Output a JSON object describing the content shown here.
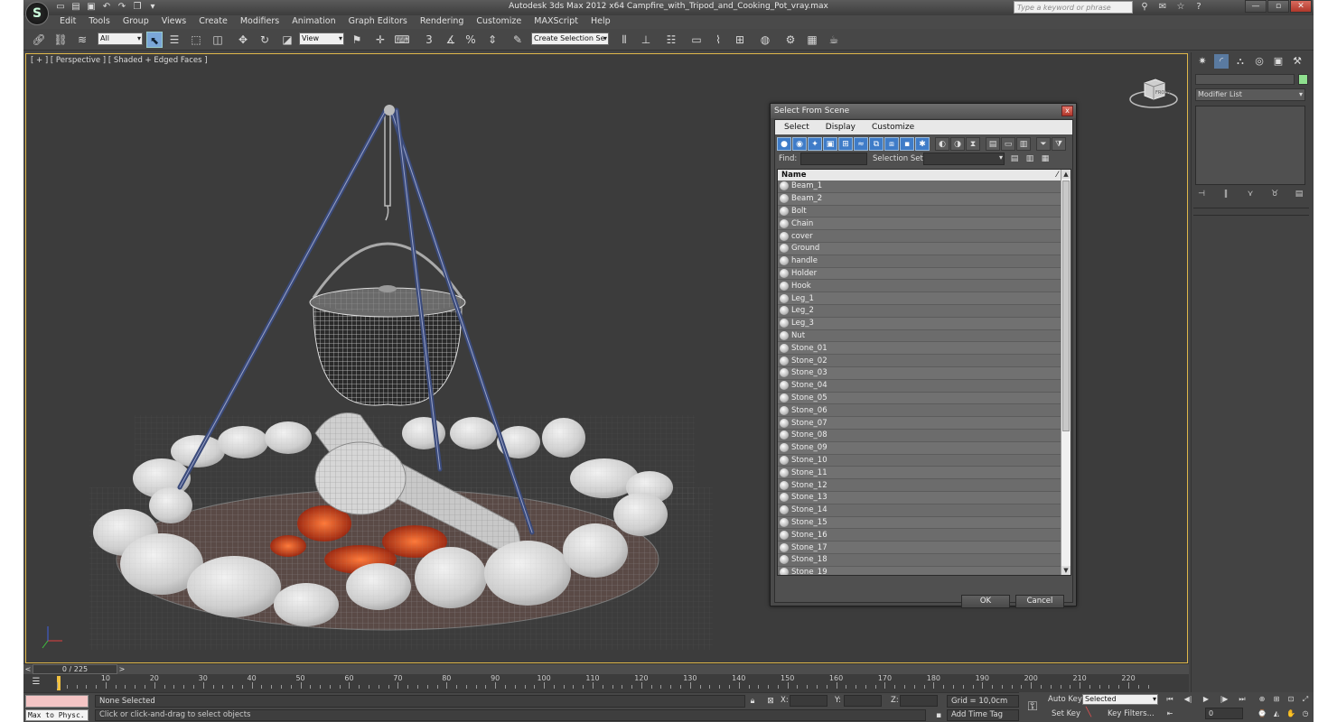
{
  "titlebar": {
    "title": "Autodesk 3ds Max  2012 x64      Campfire_with_Tripod_and_Cooking_Pot_vray.max",
    "search_placeholder": "Type a keyword or phrase"
  },
  "menu": [
    "Edit",
    "Tools",
    "Group",
    "Views",
    "Create",
    "Modifiers",
    "Animation",
    "Graph Editors",
    "Rendering",
    "Customize",
    "MAXScript",
    "Help"
  ],
  "toolbar": {
    "selection_filter": "All",
    "reference_coord": "View",
    "named_selection": "Create Selection Se",
    "snap_toggle": "3",
    "percent_snap": "%"
  },
  "viewport": {
    "label": "[ + ] [ Perspective ] [ Shaded + Edged Faces ]",
    "viewcube_label": "FRONT"
  },
  "command_panel": {
    "modifier_list": "Modifier List",
    "accent_color": "#8fe08f"
  },
  "time_slider": {
    "position": "0 / 225",
    "prev_arrow": "<",
    "next_arrow": ">"
  },
  "track_ticks": [
    "10",
    "20",
    "30",
    "40",
    "50",
    "60",
    "70",
    "80",
    "90",
    "100",
    "110",
    "120",
    "130",
    "140",
    "150",
    "160",
    "170",
    "180",
    "190",
    "200",
    "210",
    "220"
  ],
  "status": {
    "maxscript_label": "Max to Physc.",
    "selection": "None Selected",
    "prompt": "Click or click-and-drag to select objects",
    "x_label": "X:",
    "y_label": "Y:",
    "z_label": "Z:",
    "grid": "Grid = 10,0cm",
    "add_time_tag": "Add Time Tag"
  },
  "anim": {
    "auto_key": "Auto Key",
    "set_key": "Set Key",
    "selected": "Selected",
    "key_filters": "Key Filters...",
    "current_frame": "0"
  },
  "dialog": {
    "title": "Select From Scene",
    "close": "x",
    "menu": [
      "Select",
      "Display",
      "Customize"
    ],
    "find_label": "Find:",
    "selset_label": "Selection Set:",
    "column_name": "Name",
    "ok": "OK",
    "cancel": "Cancel",
    "objects": [
      "Beam_1",
      "Beam_2",
      "Bolt",
      "Chain",
      "cover",
      "Ground",
      "handle",
      "Holder",
      "Hook",
      "Leg_1",
      "Leg_2",
      "Leg_3",
      "Nut",
      "Stone_01",
      "Stone_02",
      "Stone_03",
      "Stone_04",
      "Stone_05",
      "Stone_06",
      "Stone_07",
      "Stone_08",
      "Stone_09",
      "Stone_10",
      "Stone_11",
      "Stone_12",
      "Stone_13",
      "Stone_14",
      "Stone_15",
      "Stone_16",
      "Stone_17",
      "Stone_18",
      "Stone_19"
    ]
  }
}
